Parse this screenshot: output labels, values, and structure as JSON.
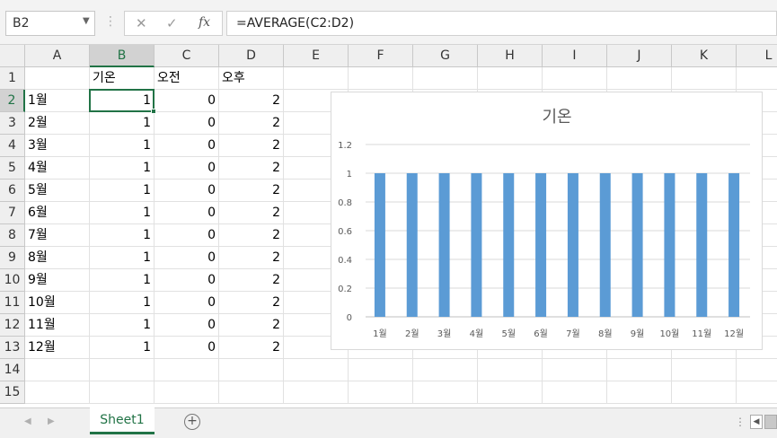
{
  "formula_bar": {
    "name_box": "B2",
    "cancel_icon": "✕",
    "enter_icon": "✓",
    "fx_label": "fx",
    "formula": "=AVERAGE(C2:D2)"
  },
  "columns": [
    "A",
    "B",
    "C",
    "D",
    "E",
    "F",
    "G",
    "H",
    "I",
    "J",
    "K",
    "L"
  ],
  "rows": [
    "1",
    "2",
    "3",
    "4",
    "5",
    "6",
    "7",
    "8",
    "9",
    "10",
    "11",
    "12",
    "13",
    "14",
    "15"
  ],
  "active_cell": {
    "column": "B",
    "row": "2"
  },
  "headers": {
    "B": "기온",
    "C": "오전",
    "D": "오후"
  },
  "data_rows": [
    {
      "A": "1월",
      "B": "1",
      "C": "0",
      "D": "2"
    },
    {
      "A": "2월",
      "B": "1",
      "C": "0",
      "D": "2"
    },
    {
      "A": "3월",
      "B": "1",
      "C": "0",
      "D": "2"
    },
    {
      "A": "4월",
      "B": "1",
      "C": "0",
      "D": "2"
    },
    {
      "A": "5월",
      "B": "1",
      "C": "0",
      "D": "2"
    },
    {
      "A": "6월",
      "B": "1",
      "C": "0",
      "D": "2"
    },
    {
      "A": "7월",
      "B": "1",
      "C": "0",
      "D": "2"
    },
    {
      "A": "8월",
      "B": "1",
      "C": "0",
      "D": "2"
    },
    {
      "A": "9월",
      "B": "1",
      "C": "0",
      "D": "2"
    },
    {
      "A": "10월",
      "B": "1",
      "C": "0",
      "D": "2"
    },
    {
      "A": "11월",
      "B": "1",
      "C": "0",
      "D": "2"
    },
    {
      "A": "12월",
      "B": "1",
      "C": "0",
      "D": "2"
    }
  ],
  "chart_data": {
    "type": "bar",
    "title": "기온",
    "categories": [
      "1월",
      "2월",
      "3월",
      "4월",
      "5월",
      "6월",
      "7월",
      "8월",
      "9월",
      "10월",
      "11월",
      "12월"
    ],
    "series": [
      {
        "values": [
          1,
          1,
          1,
          1,
          1,
          1,
          1,
          1,
          1,
          1,
          1,
          1
        ],
        "color": "#5b9bd5"
      }
    ],
    "ylim": [
      0,
      1.2
    ],
    "yticks": [
      "0",
      "0.2",
      "0.4",
      "0.6",
      "0.8",
      "1",
      "1.2"
    ],
    "grid": true
  },
  "sheet_tabs": [
    {
      "label": "Sheet1",
      "active": true
    }
  ],
  "colors": {
    "accent": "#217346",
    "bar": "#5b9bd5"
  }
}
